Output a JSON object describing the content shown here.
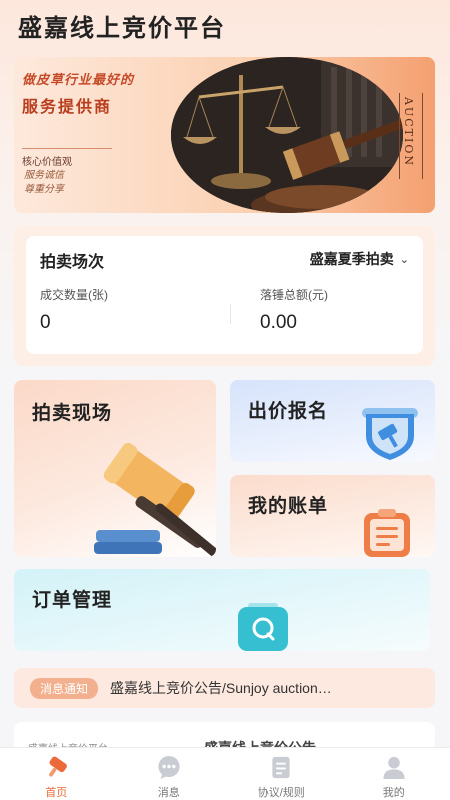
{
  "header": {
    "title": "盛嘉线上竞价平台"
  },
  "banner": {
    "slogan_line1": "做皮草行业最好的",
    "slogan_line2": "服务提供商",
    "values_title": "核心价值观",
    "values": [
      "服务诚信",
      "尊重分享"
    ],
    "side_text": "AUCTION"
  },
  "session": {
    "label": "拍卖场次",
    "selected": "盛嘉夏季拍卖",
    "stats": [
      {
        "label": "成交数量(张)",
        "value": "0"
      },
      {
        "label": "落锤总额(元)",
        "value": "0.00"
      }
    ]
  },
  "tiles": {
    "live": "拍卖现场",
    "bid": "出价报名",
    "bill": "我的账单",
    "orders": "订单管理"
  },
  "notice": {
    "tag": "消息通知",
    "text": "盛嘉线上竞价公告/Sunjoy auction…"
  },
  "peek": {
    "left": "盛嘉线上竞价平台",
    "right": "盛嘉线上竞价公告"
  },
  "tabbar": [
    {
      "label": "首页",
      "icon": "home-icon",
      "active": true
    },
    {
      "label": "消息",
      "icon": "message-icon"
    },
    {
      "label": "协议/规则",
      "icon": "document-icon"
    },
    {
      "label": "我的",
      "icon": "profile-icon"
    }
  ],
  "colors": {
    "accent": "#ec6a3a",
    "banner_text": "#c64a28"
  }
}
